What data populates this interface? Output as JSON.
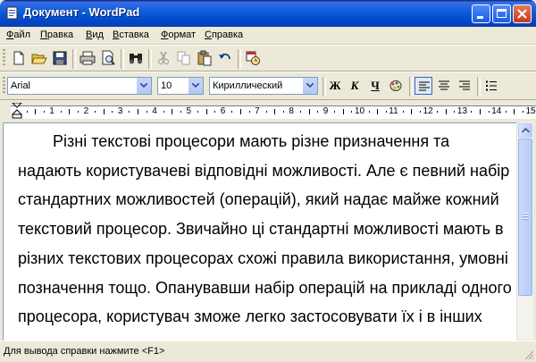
{
  "window": {
    "title": "Документ - WordPad"
  },
  "menu": [
    {
      "first": "Ф",
      "rest": "айл"
    },
    {
      "first": "П",
      "rest": "равка"
    },
    {
      "first": "В",
      "rest": "ид"
    },
    {
      "first": "В",
      "rest": "ставка"
    },
    {
      "first": "Ф",
      "rest": "ормат"
    },
    {
      "first": "С",
      "rest": "правка"
    }
  ],
  "toolbar": {
    "icons": [
      "new-document-icon",
      "open-folder-icon",
      "save-disk-icon",
      "print-icon",
      "print-preview-icon",
      "find-binoculars-icon",
      "cut-scissors-icon",
      "copy-icon",
      "paste-icon",
      "undo-icon",
      "insert-datetime-icon"
    ]
  },
  "format_bar": {
    "font_name": "Arial",
    "font_size": "10",
    "script": "Кириллический",
    "bold_label": "Ж",
    "italic_label": "К",
    "underline_label": "Ч",
    "alignment_selected": "left"
  },
  "ruler": {
    "numbers": [
      "1",
      "2",
      "3",
      "4",
      "5",
      "6",
      "7",
      "8",
      "9",
      "10",
      "11",
      "12",
      "13",
      "14",
      "15"
    ]
  },
  "document": {
    "text": "Різні текстові процесори мають різне призначення та надають користувачеві відповідні можливості. Але є певний набір стандартних можливостей (операцій), який надає майже кожний текстовий процесор. Звичайно ці стандартні можливості мають в різних текстових процесорах схожі правила використання, умовні позначення тощо. Опанувавши набір операцій на прикладі одного процесора, користувач зможе легко застосовувати їх і в інших текстових процесорах."
  },
  "status": {
    "text": "Для вывода справки нажмите <F1>"
  },
  "colors": {
    "title_bar": "#0A5DD8",
    "chrome": "#ECE9D8",
    "close_button": "#C83A12"
  }
}
